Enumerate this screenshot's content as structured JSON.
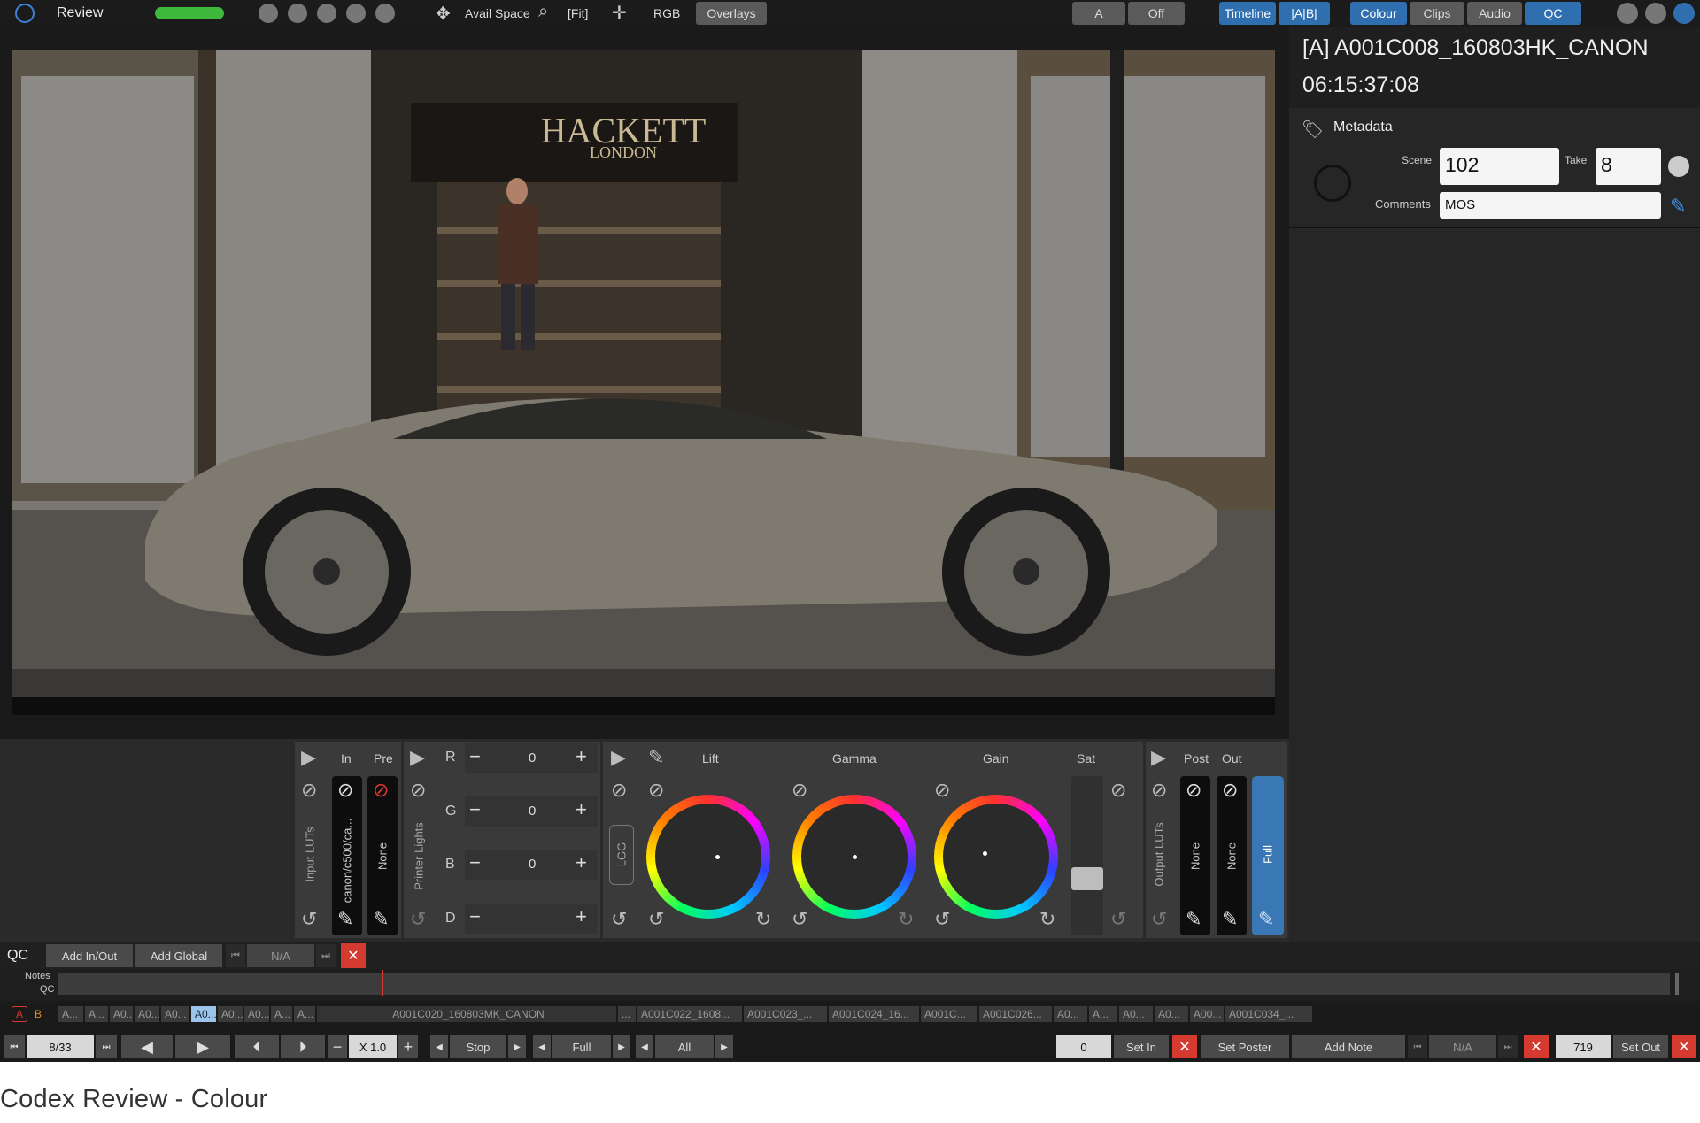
{
  "topbar": {
    "title": "Review",
    "avail_space": "Avail Space",
    "fit": "[Fit]",
    "rgb": "RGB",
    "overlays": "Overlays",
    "a_label": "A",
    "off_label": "Off",
    "timeline": "Timeline",
    "ab": "|A|B|",
    "tabs": [
      "Colour",
      "Clips",
      "Audio",
      "QC"
    ]
  },
  "video": {
    "sign_main": "HACKETT",
    "sign_sub": "LONDON"
  },
  "clip_info": {
    "name": "[A] A001C008_160803HK_CANON",
    "timecode": "06:15:37:08"
  },
  "metadata": {
    "heading": "Metadata",
    "scene_label": "Scene",
    "scene_value": "102",
    "take_label": "Take",
    "take_value": "8",
    "comments_label": "Comments",
    "comments_value": "MOS"
  },
  "colour": {
    "in_label": "In",
    "pre_label": "Pre",
    "input_luts": "Input LUTs",
    "input_lut_value": "canon/c500/ca...",
    "pre_value": "None",
    "printer_lights": "Printer Lights",
    "rows": [
      {
        "label": "R",
        "value": "0"
      },
      {
        "label": "G",
        "value": "0"
      },
      {
        "label": "B",
        "value": "0"
      },
      {
        "label": "D",
        "value": ""
      }
    ],
    "lgg": "LGG",
    "lift": "Lift",
    "gamma": "Gamma",
    "gain": "Gain",
    "sat": "Sat",
    "post_label": "Post",
    "out_label": "Out",
    "output_luts": "Output LUTs",
    "post_value": "None",
    "out_value": "None",
    "full": "Full"
  },
  "qc": {
    "label": "QC",
    "add_inout": "Add In/Out",
    "add_global": "Add Global",
    "na": "N/A",
    "notes": "Notes",
    "qc_row": "QC"
  },
  "timeline": {
    "track_a": "A",
    "track_b": "B",
    "clips": [
      "A...",
      "A...",
      "A0...",
      "A0...",
      "A0...",
      "A0...",
      "A0...",
      "A0...",
      "A...",
      "A...",
      "A001C020_160803MK_CANON",
      "...",
      "A001C022_1608...",
      "A001C023_...",
      "A001C024_16...",
      "A001C...",
      "A001C026...",
      "A0...",
      "A...",
      "A0...",
      "A0...",
      "A00...",
      "A001C034_..."
    ]
  },
  "transport": {
    "counter": "8/33",
    "speed": "X 1.0",
    "stop": "Stop",
    "full": "Full",
    "all": "All",
    "in_value": "0",
    "set_in": "Set In",
    "set_poster": "Set Poster",
    "add_note": "Add Note",
    "na": "N/A",
    "out_value": "719",
    "set_out": "Set Out"
  },
  "caption": "Codex Review - Colour",
  "colors": {
    "accent": "#2f6fb0",
    "progress": "#3db83a",
    "close": "#d43a2f"
  }
}
